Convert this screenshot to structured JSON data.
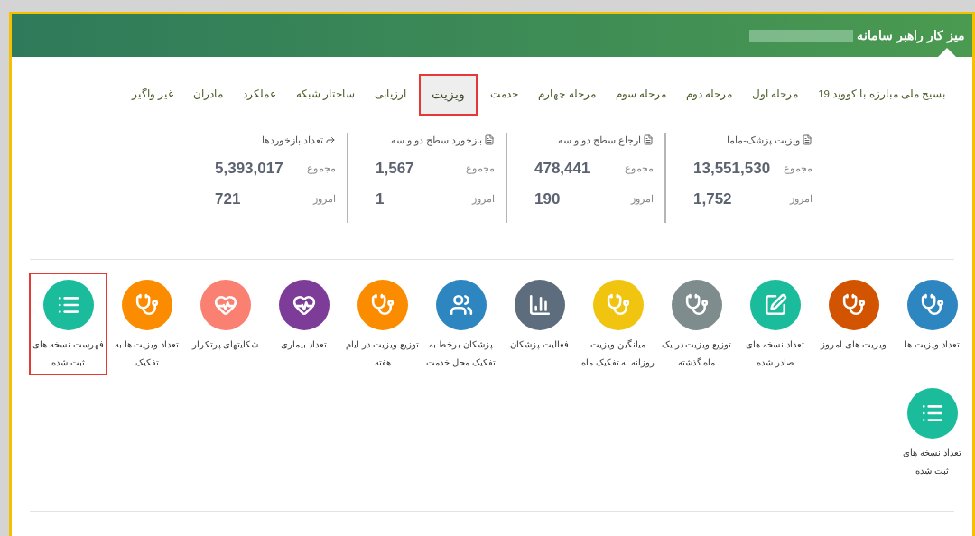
{
  "header": {
    "title": "میز کار راهبر سامانه"
  },
  "tabs": [
    {
      "label": "بسیج ملی مبارزه با کووید 19",
      "selected": false
    },
    {
      "label": "مرحله اول",
      "selected": false
    },
    {
      "label": "مرحله دوم",
      "selected": false
    },
    {
      "label": "مرحله سوم",
      "selected": false
    },
    {
      "label": "مرحله چهارم",
      "selected": false
    },
    {
      "label": "خدمت",
      "selected": false
    },
    {
      "label": "ویزیت",
      "selected": true
    },
    {
      "label": "ارزیابی",
      "selected": false
    },
    {
      "label": "ساختار شبکه",
      "selected": false
    },
    {
      "label": "عملکرد",
      "selected": false
    },
    {
      "label": "مادران",
      "selected": false
    },
    {
      "label": "غیر واگیر",
      "selected": false
    }
  ],
  "stats": [
    {
      "title": "ویزیت پزشک-ماما",
      "kind": "document",
      "rows": [
        {
          "label": "مجموع",
          "value": "13,551,530"
        },
        {
          "label": "امروز",
          "value": "1,752"
        }
      ]
    },
    {
      "title": "ارجاع سطح دو و سه",
      "kind": "document",
      "rows": [
        {
          "label": "مجموع",
          "value": "478,441"
        },
        {
          "label": "امروز",
          "value": "190"
        }
      ]
    },
    {
      "title": "بازخورد سطح دو و سه",
      "kind": "document",
      "rows": [
        {
          "label": "مجموع",
          "value": "1,567"
        },
        {
          "label": "امروز",
          "value": "1"
        }
      ]
    },
    {
      "title": "تعداد بازخوردها",
      "kind": "share",
      "rows": [
        {
          "label": "مجموع",
          "value": "5,393,017"
        },
        {
          "label": "امروز",
          "value": "721"
        }
      ]
    }
  ],
  "tiles": [
    {
      "label": "تعداد ویزیت ها",
      "kind": "stethoscope",
      "color": "#2e86c1",
      "highlighted": false
    },
    {
      "label": "ویزیت های امروز",
      "kind": "stethoscope",
      "color": "#d35400",
      "highlighted": false
    },
    {
      "label": "تعداد نسخه های صادر شده",
      "kind": "edit",
      "color": "#1abc9c",
      "highlighted": false
    },
    {
      "label": "توزیع ویزیت در یک ماه گذشته",
      "kind": "stethoscope",
      "color": "#7f8c8d",
      "highlighted": false
    },
    {
      "label": "میانگین ویزیت روزانه به تفکیک ماه",
      "kind": "stethoscope",
      "color": "#f1c40f",
      "highlighted": false
    },
    {
      "label": "فعالیت پزشکان",
      "kind": "chart",
      "color": "#5d6d7e",
      "highlighted": false
    },
    {
      "label": "پزشکان برخط به تفکیک محل خدمت",
      "kind": "users",
      "color": "#2e86c1",
      "highlighted": false
    },
    {
      "label": "توزیع ویزیت در ایام هفته",
      "kind": "stethoscope",
      "color": "#fb8c00",
      "highlighted": false
    },
    {
      "label": "تعداد بیماری",
      "kind": "heart",
      "color": "#7d3c98",
      "highlighted": false
    },
    {
      "label": "شکایتهای پرتکرار",
      "kind": "heart",
      "color": "#fa8072",
      "highlighted": false
    },
    {
      "label": "تعداد ویزیت ها به تفکیک",
      "kind": "stethoscope",
      "color": "#fb8c00",
      "highlighted": false
    },
    {
      "label": "فهرست نسخه های ثبت شده",
      "kind": "list",
      "color": "#1abc9c",
      "highlighted": true
    },
    {
      "label": "تعداد نسخه های ثبت شده",
      "kind": "list",
      "color": "#1abc9c",
      "highlighted": false
    }
  ]
}
